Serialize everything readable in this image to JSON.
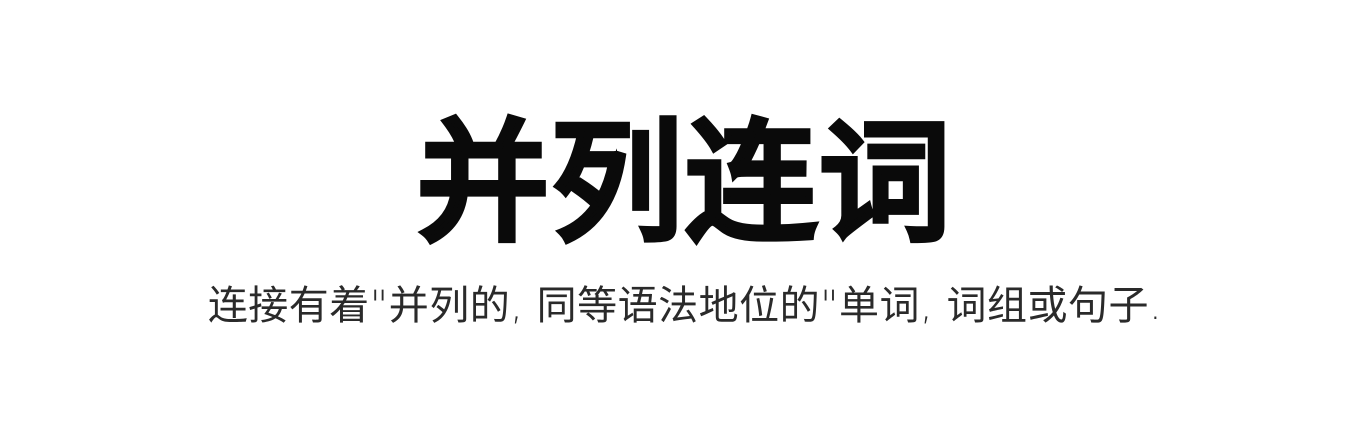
{
  "slide": {
    "title": "并列连词",
    "subtitle": "连接有着\"并列的, 同等语法地位的\"单词, 词组或句子."
  }
}
